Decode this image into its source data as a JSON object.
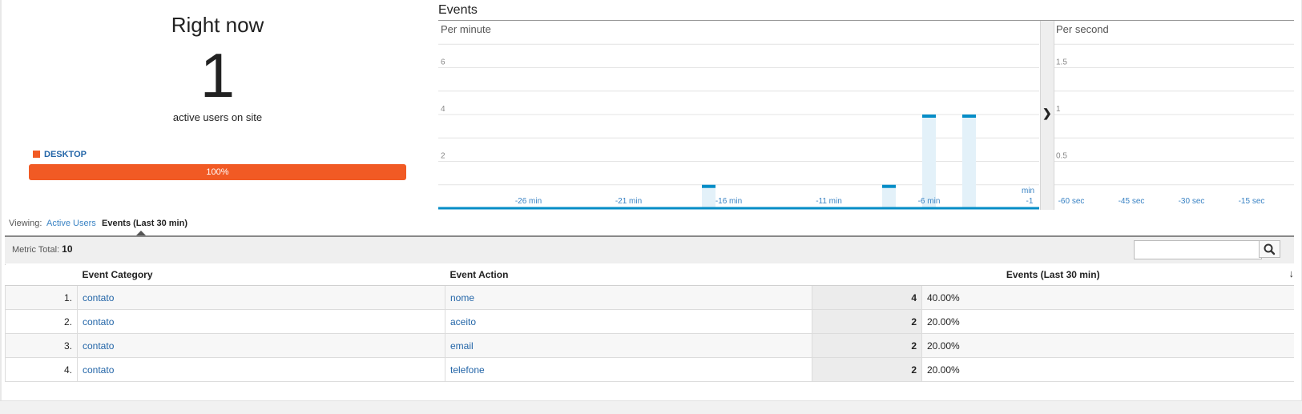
{
  "right_now": {
    "title": "Right now",
    "count": "1",
    "subtitle": "active users on site",
    "device_label": "DESKTOP",
    "device_percent": "100%",
    "device_fraction": 1.0,
    "device_color": "#f15a24"
  },
  "events_panel": {
    "title": "Events",
    "per_minute_label": "Per minute",
    "per_second_label": "Per second",
    "minute_min_label": "min",
    "expand_icon": "chevron-right-icon"
  },
  "chart_data": [
    {
      "type": "bar",
      "title": "Per minute",
      "x_unit": "min",
      "x": [
        -30,
        -29,
        -28,
        -27,
        -26,
        -25,
        -24,
        -23,
        -22,
        -21,
        -20,
        -19,
        -18,
        -17,
        -16,
        -15,
        -14,
        -13,
        -12,
        -11,
        -10,
        -9,
        -8,
        -7,
        -6,
        -5,
        -4,
        -3,
        -2,
        -1
      ],
      "values": [
        0,
        0,
        0,
        0,
        0,
        0,
        0,
        0,
        0,
        0,
        0,
        0,
        0,
        1,
        0,
        0,
        0,
        0,
        0,
        0,
        0,
        0,
        1,
        0,
        4,
        0,
        4,
        0,
        0,
        0
      ],
      "xtick_labels": [
        "-26 min",
        "-21 min",
        "-16 min",
        "-11 min",
        "-6 min",
        "-1"
      ],
      "yticks": [
        2,
        4,
        6
      ],
      "ylim": [
        0,
        8
      ],
      "bar_color": "#058dc7",
      "bar_fill": "#e3f1f9",
      "grid": true
    },
    {
      "type": "bar",
      "title": "Per second",
      "x": [
        -60,
        -45,
        -30,
        -15
      ],
      "xtick_labels": [
        "-60 sec",
        "-45 sec",
        "-30 sec",
        "-15 sec"
      ],
      "values": [
        0,
        0,
        0,
        0
      ],
      "yticks": [
        0.5,
        1,
        1.5
      ],
      "ylim": [
        0,
        2
      ],
      "bar_color": "#058dc7",
      "grid": true
    }
  ],
  "viewing": {
    "label": "Viewing:",
    "tabs": [
      "Active Users",
      "Events (Last 30 min)"
    ],
    "active_tab": "Events (Last 30 min)"
  },
  "metric": {
    "label": "Metric Total:",
    "value": "10",
    "search_placeholder": "",
    "search_icon": "search-icon"
  },
  "table": {
    "headers": [
      "Event Category",
      "Event Action",
      "Events (Last 30 min)"
    ],
    "sort_icon": "arrow-down-icon",
    "rows": [
      {
        "idx": "1.",
        "category": "contato",
        "action": "nome",
        "value": "4",
        "pct": "40.00%"
      },
      {
        "idx": "2.",
        "category": "contato",
        "action": "aceito",
        "value": "2",
        "pct": "20.00%"
      },
      {
        "idx": "3.",
        "category": "contato",
        "action": "email",
        "value": "2",
        "pct": "20.00%"
      },
      {
        "idx": "4.",
        "category": "contato",
        "action": "telefone",
        "value": "2",
        "pct": "20.00%"
      }
    ]
  }
}
